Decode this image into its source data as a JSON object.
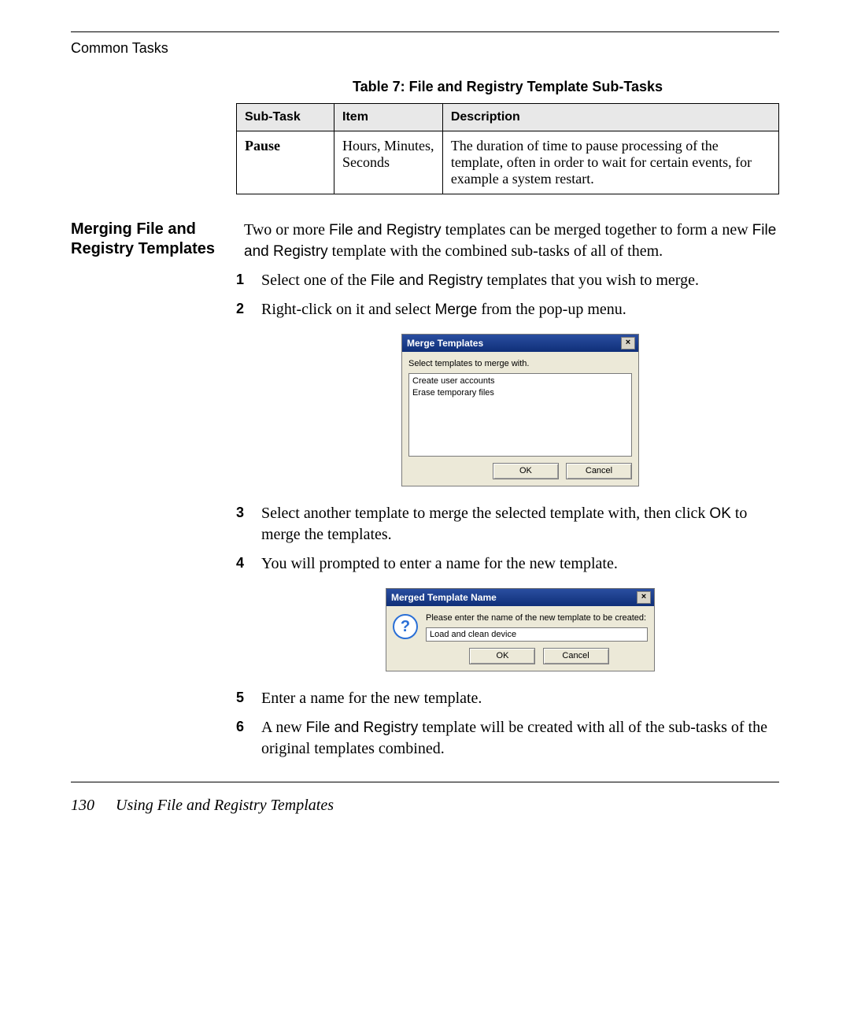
{
  "running_head": "Common Tasks",
  "table_caption": "Table 7: File and Registry Template Sub-Tasks",
  "table": {
    "headers": [
      "Sub-Task",
      "Item",
      "Description"
    ],
    "row": {
      "subtask": "Pause",
      "item": "Hours, Minutes, Seconds",
      "description": "The duration of time to pause processing of the template, often in order to wait for certain events, for example a system restart."
    }
  },
  "section_heading": "Merging File and Registry Templates",
  "intro": {
    "pre1": "Two or more ",
    "sans1": "File and Registry",
    "mid1": " templates can be merged together to form a new ",
    "sans2": "File and Registry",
    "post1": " template with the combined sub-tasks of all of them."
  },
  "steps": {
    "s1_pre": "Select one of the ",
    "s1_sans": "File and Registry",
    "s1_post": " templates that you wish to merge.",
    "s2_pre": "Right-click on it and select ",
    "s2_sans": "Merge",
    "s2_post": " from the pop-up menu.",
    "s3_pre": "Select another template to merge the selected template with, then click ",
    "s3_sans": "OK",
    "s3_post": " to merge the templates.",
    "s4": "You will prompted to enter a name for the new template.",
    "s5": "Enter a name for the new template.",
    "s6_pre": "A new ",
    "s6_sans": "File and Registry",
    "s6_post": " template will be created with all of the sub-tasks of the original templates combined."
  },
  "dialog_a": {
    "title": "Merge Templates",
    "close": "×",
    "instruction": "Select templates to merge with.",
    "options": [
      "Create user accounts",
      "Erase temporary files"
    ],
    "ok": "OK",
    "cancel": "Cancel"
  },
  "dialog_b": {
    "title": "Merged Template Name",
    "close": "×",
    "prompt": "Please enter the name of the new template to be created:",
    "input_value": "Load and clean device",
    "ok": "OK",
    "cancel": "Cancel",
    "qmark": "?"
  },
  "footer": {
    "page": "130",
    "title": "Using File and Registry Templates"
  }
}
